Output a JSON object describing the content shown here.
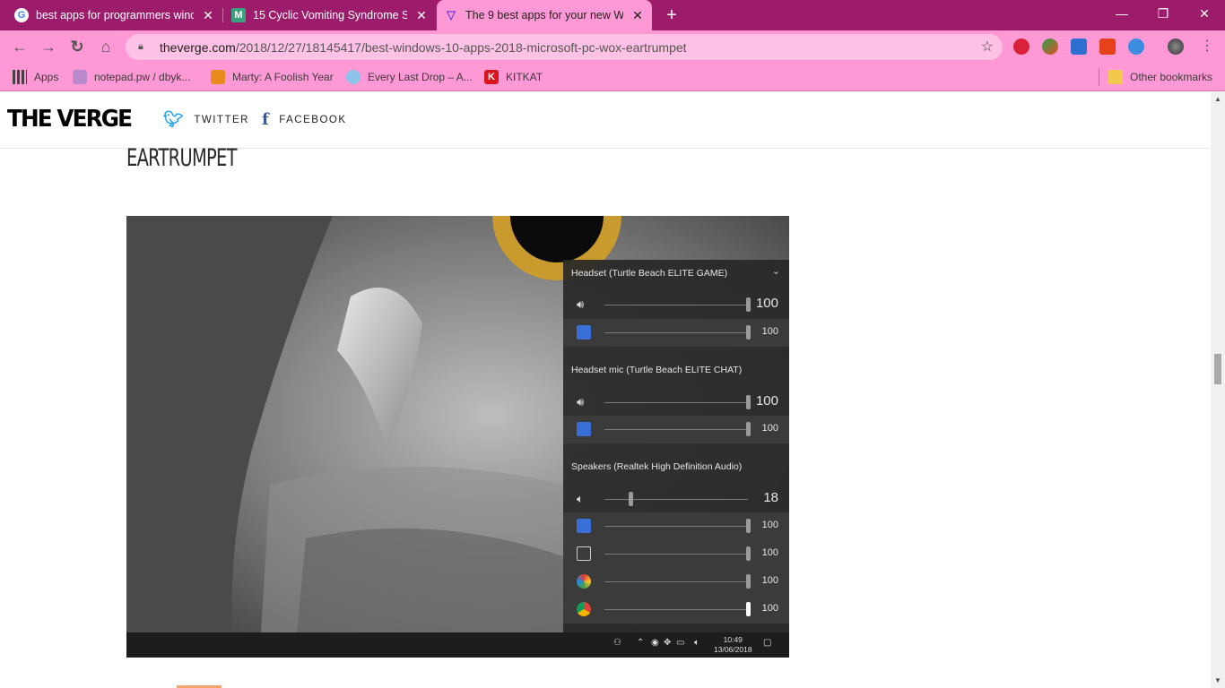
{
  "browser": {
    "tabs": [
      {
        "title": "best apps for programmers wind",
        "favicon": "google-icon",
        "active": false
      },
      {
        "title": "15 Cyclic Vomiting Syndrome Sy",
        "favicon": "m-icon",
        "active": false
      },
      {
        "title": "The 9 best apps for your new Wi",
        "favicon": "verge-icon",
        "active": true
      }
    ],
    "newtab": "+",
    "window_controls": {
      "minimize": "—",
      "restore": "❐",
      "close": "✕"
    },
    "url_host": "theverge.com",
    "url_path": "/2018/12/27/18145417/best-windows-10-apps-2018-microsoft-pc-wox-eartrumpet",
    "bookmarks": [
      {
        "label": "Apps"
      },
      {
        "label": "notepad.pw / dbyk..."
      },
      {
        "label": "Marty: A Foolish Year"
      },
      {
        "label": "Every Last Drop – A..."
      },
      {
        "label": "KITKAT"
      }
    ],
    "other_bookmarks": "Other bookmarks"
  },
  "site": {
    "logo": "THE VERGE",
    "twitter": "TWITTER",
    "facebook": "FACEBOOK",
    "heading": "EARTRUMPET"
  },
  "eartrumpet": {
    "devices": [
      {
        "name": "Headset (Turtle Beach ELITE GAME)",
        "master": "100",
        "apps": [
          "100"
        ]
      },
      {
        "name": "Headset mic (Turtle Beach ELITE CHAT)",
        "master": "100",
        "apps": [
          "100"
        ]
      },
      {
        "name": "Speakers (Realtek High Definition Audio)",
        "master": "18",
        "apps": [
          "100",
          "100",
          "100",
          "100"
        ]
      }
    ],
    "levels": {
      "dev0": 1.0,
      "dev0app": 1.0,
      "dev1": 1.0,
      "dev1app": 1.0,
      "dev2": 0.18,
      "dev2apps": [
        1.0,
        1.0,
        1.0,
        1.0
      ]
    },
    "clock_time": "10:49",
    "clock_date": "13/06/2018"
  }
}
